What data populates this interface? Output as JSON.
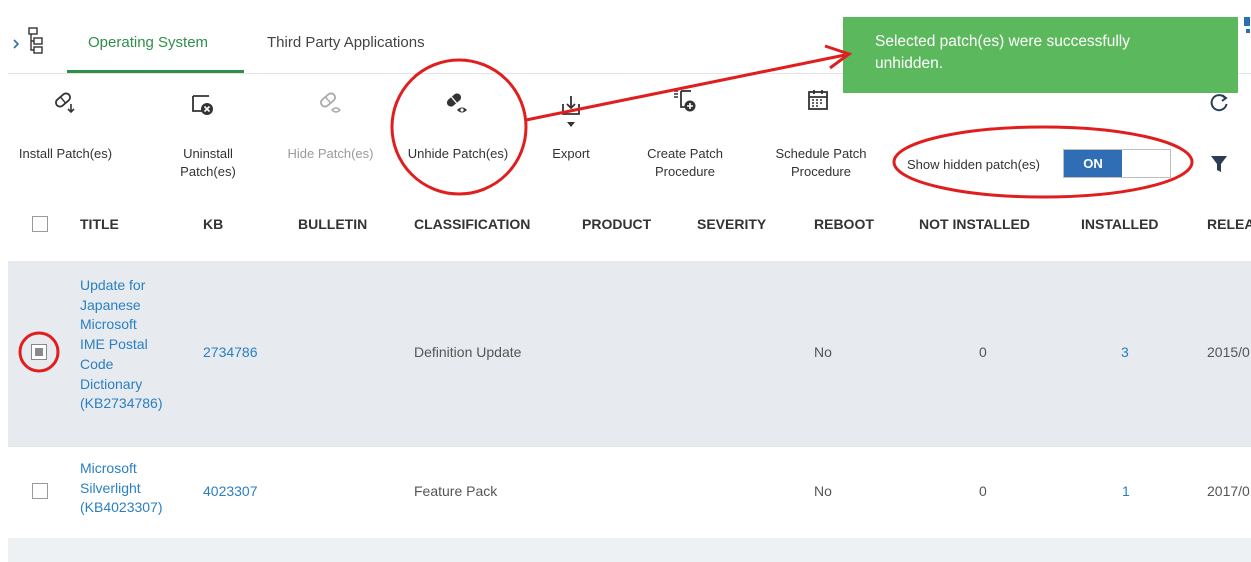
{
  "tabs": [
    {
      "label": "Operating System",
      "active": true
    },
    {
      "label": "Third Party Applications",
      "active": false
    }
  ],
  "toast": {
    "message": "Selected patch(es) were successfully unhidden.",
    "color": "#5cb85c"
  },
  "toolbar": {
    "install": "Install Patch(es)",
    "uninstall_line1": "Uninstall",
    "uninstall_line2": "Patch(es)",
    "hide": "Hide Patch(es)",
    "unhide": "Unhide Patch(es)",
    "export": "Export",
    "create_line1": "Create Patch",
    "create_line2": "Procedure",
    "schedule_line1": "Schedule Patch",
    "schedule_line2": "Procedure",
    "show_hidden_label": "Show hidden patch(es)",
    "toggle_state": "ON"
  },
  "table": {
    "headers": {
      "title": "TITLE",
      "kb": "KB",
      "bulletin": "BULLETIN",
      "classification": "CLASSIFICATION",
      "product": "PRODUCT",
      "severity": "SEVERITY",
      "reboot": "REBOOT",
      "not_installed": "NOT INSTALLED",
      "installed": "INSTALLED",
      "release": "RELEA"
    },
    "rows": [
      {
        "selected": true,
        "title_lines": [
          "Update for",
          "Japanese",
          "Microsoft",
          "IME Postal",
          "Code",
          "Dictionary",
          "(KB2734786)"
        ],
        "kb": "2734786",
        "classification": "Definition Update",
        "reboot": "No",
        "not_installed": "0",
        "installed": "3",
        "release": "2015/0"
      },
      {
        "selected": false,
        "title_lines": [
          "Microsoft",
          "Silverlight",
          "(KB4023307)"
        ],
        "kb": "4023307",
        "classification": "Feature Pack",
        "reboot": "No",
        "not_installed": "0",
        "installed": "1",
        "release": "2017/0"
      }
    ]
  },
  "colors": {
    "accent_green": "#2e8f4a",
    "link_blue": "#2a7fc1",
    "toggle_blue": "#2f6db5",
    "annotation_red": "#e01e1e"
  }
}
